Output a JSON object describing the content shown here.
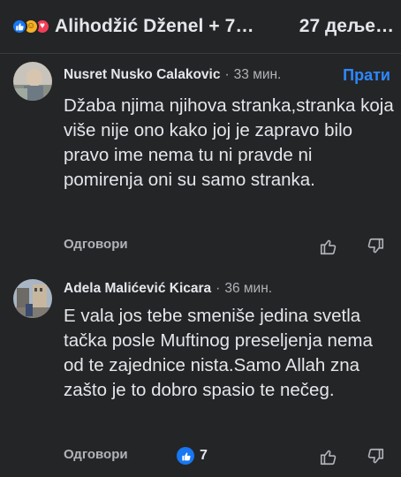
{
  "header": {
    "names": "Alihodžić Dženel + 7…",
    "shares": "27 деље…",
    "reaction_icons": [
      "like-icon",
      "care-icon",
      "love-icon"
    ]
  },
  "comments": [
    {
      "author": "Nusret Nusko Calakovic",
      "time": "33 мин.",
      "follow_label": "Прати",
      "text": "Džaba njima njihova stranka,stranka koja više nije ono kako joj je zapravo bilo pravo ime nema tu ni pravde ni pomirenja oni su samo stranka.",
      "reply_label": "Одговори"
    },
    {
      "author": "Adela Malićević Kicara",
      "time": "36 мин.",
      "text": "E vala jos tebe smeniše jedina svetla tačka posle Muftinog preseljenja nema od te zajednice nista.Samo Allah zna zašto je to dobro spasio te nečeg.",
      "reply_label": "Одговори",
      "like_count": "7"
    }
  ],
  "colors": {
    "background": "#242526",
    "text": "#e4e6eb",
    "secondary": "#b0b3b8",
    "accent": "#2d88ff"
  }
}
